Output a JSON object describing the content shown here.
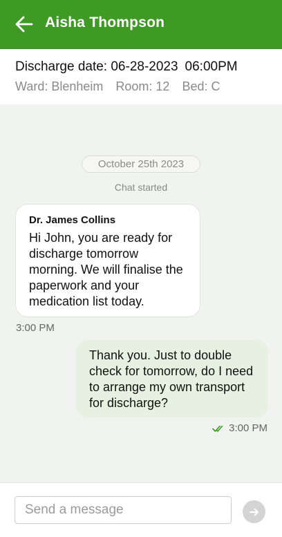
{
  "header": {
    "title": "Aisha Thompson",
    "back_icon": "arrow-left-icon",
    "background": "#3f9a25"
  },
  "patient": {
    "discharge_label": "Discharge date: 06-28-2023",
    "discharge_time": "06:00PM",
    "ward": "Ward: Blenheim",
    "room": "Room: 12",
    "bed": "Bed: C"
  },
  "chat": {
    "date": "October 25th 2023",
    "started": "Chat started",
    "messages": [
      {
        "sender": "Dr. James Collins",
        "text": "Hi John, you are ready for discharge tomorrow morning. We will finalise the paperwork and your medication list today.",
        "time": "3:00 PM",
        "direction": "incoming"
      },
      {
        "text": "Thank you. Just to double check for tomorrow, do I need to arrange my own transport for discharge?",
        "time": "3:00 PM",
        "direction": "outgoing",
        "status_icon": "double-check-icon"
      }
    ]
  },
  "composer": {
    "placeholder": "Send a message",
    "value": "",
    "send_icon": "arrow-right-icon"
  }
}
